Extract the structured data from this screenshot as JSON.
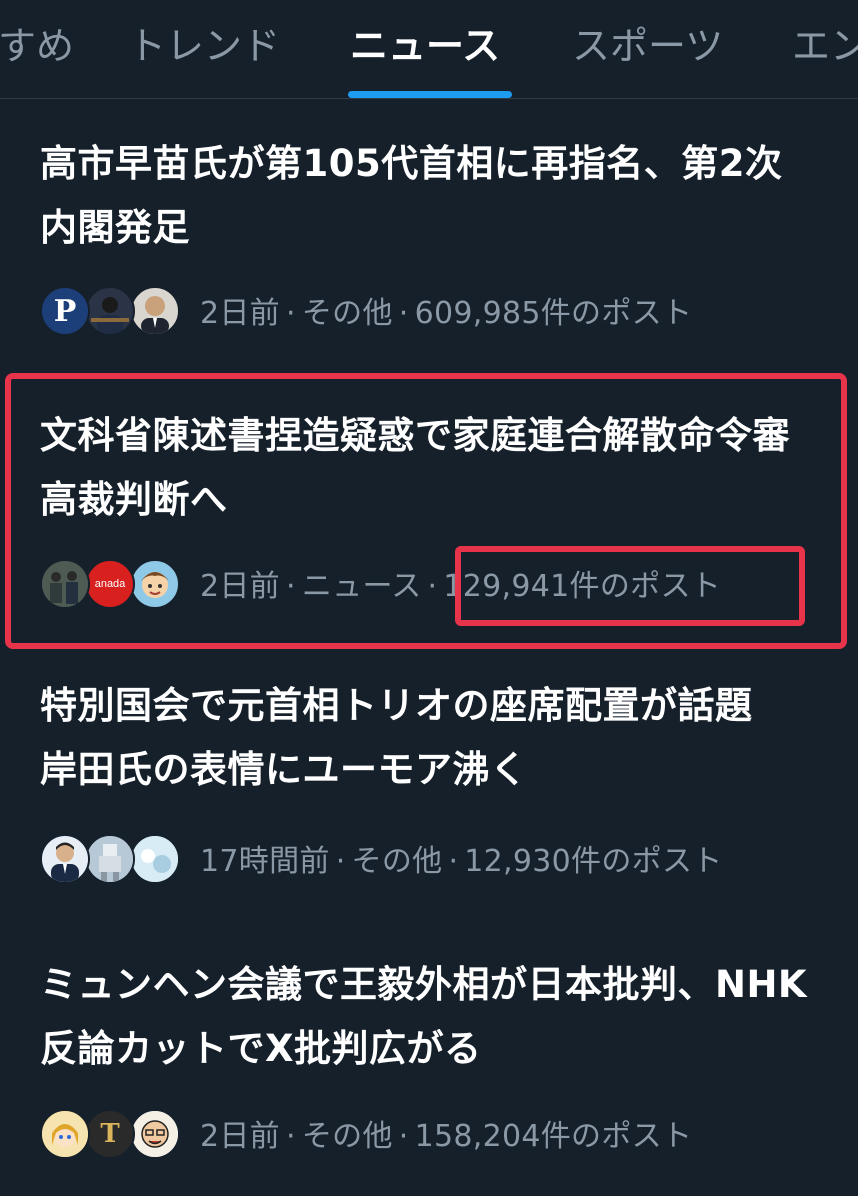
{
  "tabs": [
    {
      "label": "すめ",
      "active": false
    },
    {
      "label": "トレンド",
      "active": false
    },
    {
      "label": "ニュース",
      "active": true
    },
    {
      "label": "スポーツ",
      "active": false
    },
    {
      "label": "エン",
      "active": false
    }
  ],
  "news": [
    {
      "headline": "高市早苗氏が第105代首相に再指名、第2次内閣発足",
      "time": "2日前",
      "category": "その他",
      "posts": "609,985件のポスト",
      "avatars": [
        {
          "icon": "letter-p-avatar",
          "label": "P",
          "color": "#1c3f7a"
        },
        {
          "icon": "person-avatar",
          "color": "#2b3446"
        },
        {
          "icon": "person-avatar",
          "color": "#d9d5cf"
        }
      ]
    },
    {
      "headline": "文科省陳述書捏造疑惑で家庭連合解散命令審 高裁判断へ",
      "time": "2日前",
      "category": "ニュース",
      "posts": "129,941件のポスト",
      "avatars": [
        {
          "icon": "group-avatar",
          "color": "#3c4a4f"
        },
        {
          "icon": "logo-avatar",
          "label": "anada",
          "color": "#d8201f"
        },
        {
          "icon": "cartoon-boy-avatar",
          "color": "#8fc9e8"
        }
      ]
    },
    {
      "headline": "特別国会で元首相トリオの座席配置が話題　岸田氏の表情にユーモア沸く",
      "time": "17時間前",
      "category": "その他",
      "posts": "12,930件のポスト",
      "avatars": [
        {
          "icon": "person-avatar",
          "color": "#3a7bd5"
        },
        {
          "icon": "mecha-avatar",
          "color": "#9fb7c8"
        },
        {
          "icon": "snow-avatar",
          "color": "#c9e3ef"
        }
      ]
    },
    {
      "headline": "ミュンヘン会議で王毅外相が日本批判、NHK反論カットでX批判広がる",
      "time": "2日前",
      "category": "その他",
      "posts": "158,204件のポスト",
      "avatars": [
        {
          "icon": "anime-girl-avatar",
          "color": "#f2c14e"
        },
        {
          "icon": "letter-t-avatar",
          "label": "T",
          "color": "#2a2a2a"
        },
        {
          "icon": "caricature-avatar",
          "color": "#f4f0e6"
        }
      ]
    }
  ],
  "colors": {
    "background": "#15202b",
    "accent": "#1d9bf0",
    "highlight": "#e8344b",
    "meta_text": "#8b98a5"
  }
}
